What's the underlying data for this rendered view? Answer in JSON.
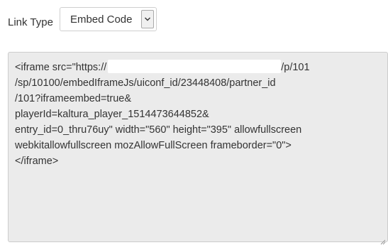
{
  "link_type": {
    "label": "Link Type",
    "selected": "Embed Code"
  },
  "embed_code": {
    "line_1_prefix": "<iframe src=\"https://",
    "line_1_suffix": "/p/101",
    "line_2": "/sp/10100/embedIframeJs/uiconf_id/23448408/partner_id",
    "line_3": "/101?iframeembed=true&",
    "line_4": "playerId=kaltura_player_1514473644852&",
    "line_5": "entry_id=0_thru76uy\" width=\"560\" height=\"395\" allowfullscreen",
    "line_6": "webkitallowfullscreen mozAllowFullScreen frameborder=\"0\">",
    "line_7": "</iframe>"
  },
  "icons": {
    "dropdown": "chevron-down-icon",
    "resize": "resize-grip-icon"
  },
  "colors": {
    "textarea_bg": "#ebebeb",
    "redaction": "#ffffff",
    "text": "#333333"
  }
}
